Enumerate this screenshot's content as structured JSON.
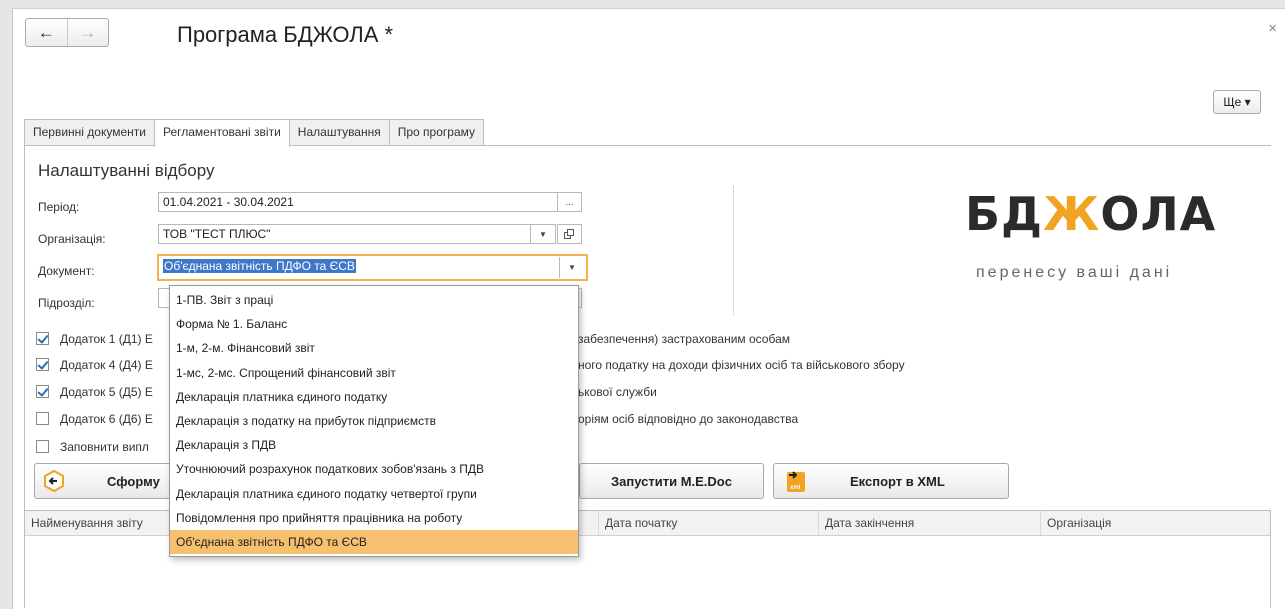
{
  "window": {
    "title": "Програма БДЖОЛА *",
    "close_glyph": "×"
  },
  "nav": {
    "back_glyph": "←",
    "forward_glyph": "→"
  },
  "more_label": "Ще ▾",
  "tabs": [
    {
      "label": "Первинні документи",
      "active": false
    },
    {
      "label": "Регламентовані звіти",
      "active": true
    },
    {
      "label": "Налаштування",
      "active": false
    },
    {
      "label": "Про програму",
      "active": false
    }
  ],
  "filters": {
    "title": "Налаштуванні відбору",
    "period": {
      "label": "Період:",
      "value": "01.04.2021 - 30.04.2021",
      "button": "..."
    },
    "organization": {
      "label": "Організація:",
      "value": "ТОВ \"ТЕСТ ПЛЮС\""
    },
    "document": {
      "label": "Документ:",
      "value": "Об'єднана звітність ПДФО та ЄСВ"
    },
    "subdivision": {
      "label": "Підрозділ:"
    }
  },
  "logo": {
    "text_a": "БД",
    "text_zh": "Ж",
    "text_b": "ОЛА",
    "tagline": "перенесу ваші дані",
    "accent": "#f0a422"
  },
  "checkboxes": [
    {
      "left": "Додаток 1 (Д1) Е",
      "right": "забезпечення) застрахованим особам",
      "checked": true
    },
    {
      "left": "Додаток 4 (Д4) Е",
      "right": "ного податку на доходи фізичних осіб та військового збору",
      "checked": true
    },
    {
      "left": "Додаток 5 (Д5) Е",
      "right": "ькової служби",
      "checked": true
    },
    {
      "left": "Додаток 6 (Д6) Е",
      "right": "оріям осіб відповідно до законодавства",
      "checked": false
    },
    {
      "left": "Заповнити випл",
      "right": "",
      "checked": false
    }
  ],
  "buttons": {
    "form": "Сформу",
    "medoc": "Запустити M.E.Doc",
    "export": "Експорт в XML"
  },
  "table": {
    "columns": [
      "Найменування звіту",
      "Дата початку",
      "Дата закінчення",
      "Організація"
    ]
  },
  "dropdown": {
    "items": [
      "1-ПВ. Звіт з праці",
      "Форма № 1. Баланс",
      "1-м, 2-м. Фінансовий звіт",
      "1-мс, 2-мс. Спрощений фінансовий звіт",
      "Декларація платника єдиного податку",
      "Декларація з податку на прибуток підприємств",
      "Декларація з ПДВ",
      "Уточнюючий розрахунок податкових зобов'язань з ПДВ",
      "Декларація платника єдиного податку четвертої групи",
      "Повідомлення про прийняття працівника на роботу",
      "Об'єднана звітність ПДФО та ЄСВ"
    ],
    "selected_index": 10
  }
}
